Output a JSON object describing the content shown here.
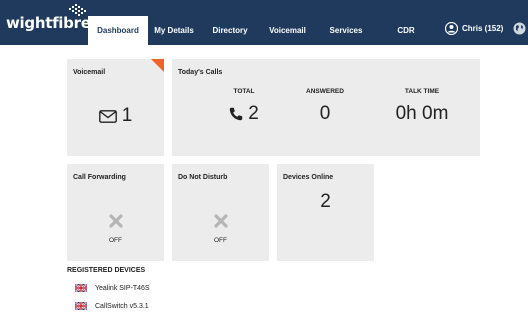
{
  "header": {
    "logo_text": "wightfibre",
    "nav": [
      {
        "label": "Dashboard",
        "active": true
      },
      {
        "label": "My Details",
        "active": false
      },
      {
        "label": "Directory",
        "active": false
      },
      {
        "label": "Voicemail",
        "active": false
      },
      {
        "label": "Services",
        "active": false
      },
      {
        "label": "CDR",
        "active": false
      }
    ],
    "user_label": "Chris (152)"
  },
  "cards": {
    "voicemail": {
      "title": "Voicemail",
      "count": "1"
    },
    "todays_calls": {
      "title": "Today's Calls",
      "columns": [
        {
          "label": "TOTAL",
          "value": "2"
        },
        {
          "label": "ANSWERED",
          "value": "0"
        },
        {
          "label": "TALK TIME",
          "value": "0h 0m"
        }
      ]
    },
    "call_forwarding": {
      "title": "Call Forwarding",
      "status": "OFF"
    },
    "do_not_disturb": {
      "title": "Do Not Disturb",
      "status": "OFF"
    },
    "devices_online": {
      "title": "Devices Online",
      "count": "2"
    }
  },
  "registered_devices": {
    "title": "REGISTERED DEVICES",
    "items": [
      {
        "name": "Yealink SIP-T46S"
      },
      {
        "name": "CallSwitch v5.3.1"
      }
    ]
  },
  "colors": {
    "header_bg": "#1f3a5c",
    "card_bg": "#ececec",
    "accent": "#f0642a"
  }
}
